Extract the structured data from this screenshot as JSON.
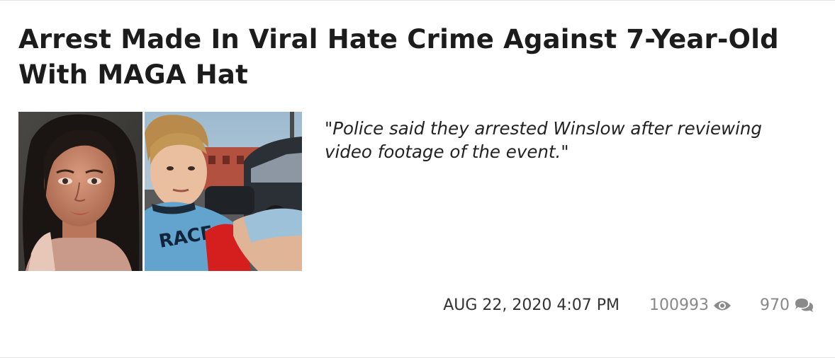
{
  "article": {
    "headline": "Arrest Made In Viral Hate Crime Against 7-Year-Old With MAGA Hat",
    "quote": "\"Police said they arrested Winslow after reviewing video footage of the event.\"",
    "thumbnail_left": "mugshot-photo",
    "thumbnail_right": "child-video-still",
    "meta": {
      "date": "AUG 22, 2020 4:07 PM",
      "views": "100993",
      "views_icon": "eye-icon",
      "comments": "970",
      "comments_icon": "comments-icon"
    }
  },
  "colors": {
    "headline": "#1c1c1c",
    "quote": "#222222",
    "date": "#333333",
    "stats": "#888888",
    "divider": "#e4e4e4"
  }
}
